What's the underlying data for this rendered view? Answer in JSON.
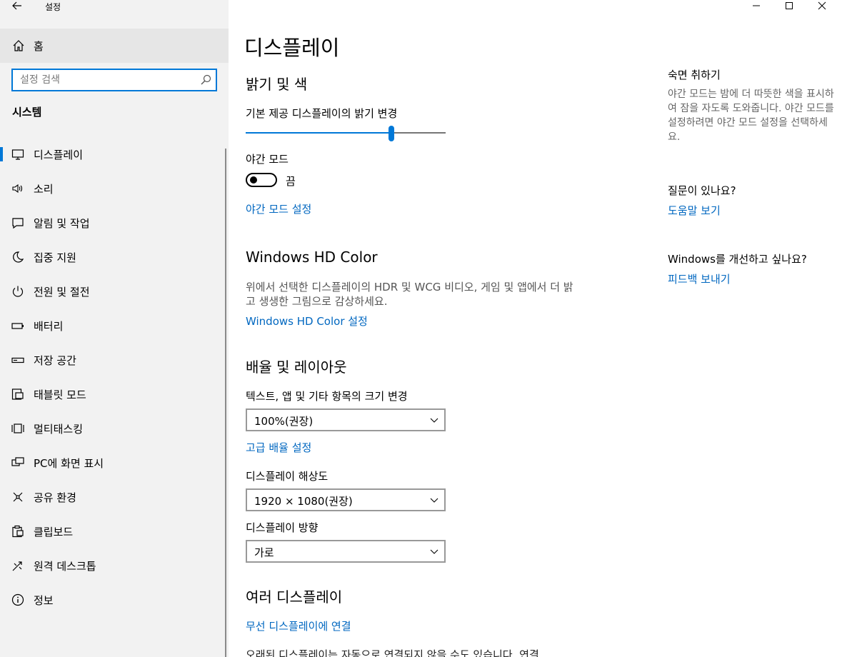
{
  "app": {
    "title": "설정"
  },
  "sidebar": {
    "home_label": "홈",
    "search_placeholder": "설정 검색",
    "section_title": "시스템",
    "items": [
      {
        "label": "디스플레이",
        "icon": "monitor-icon",
        "selected": true
      },
      {
        "label": "소리",
        "icon": "speaker-icon"
      },
      {
        "label": "알림 및 작업",
        "icon": "notification-icon"
      },
      {
        "label": "집중 지원",
        "icon": "moon-icon"
      },
      {
        "label": "전원 및 절전",
        "icon": "power-icon"
      },
      {
        "label": "배터리",
        "icon": "battery-icon"
      },
      {
        "label": "저장 공간",
        "icon": "storage-icon"
      },
      {
        "label": "태블릿 모드",
        "icon": "tablet-icon"
      },
      {
        "label": "멀티태스킹",
        "icon": "multitasking-icon"
      },
      {
        "label": "PC에 화면 표시",
        "icon": "project-icon"
      },
      {
        "label": "공유 환경",
        "icon": "shared-experiences-icon"
      },
      {
        "label": "클립보드",
        "icon": "clipboard-icon"
      },
      {
        "label": "원격 데스크톱",
        "icon": "remote-desktop-icon"
      },
      {
        "label": "정보",
        "icon": "info-icon"
      }
    ]
  },
  "main": {
    "title": "디스플레이",
    "brightness": {
      "heading": "밝기 및 색",
      "slider_label": "기본 제공 디스플레이의 밝기 변경",
      "brightness_value": 0.73,
      "night_light_label": "야간 모드",
      "night_light_state": "끔",
      "night_light_settings_link": "야간 모드 설정"
    },
    "hdr": {
      "heading": "Windows HD Color",
      "description": "위에서 선택한 디스플레이의 HDR 및 WCG 비디오, 게임 및 앱에서 더 밝고 생생한 그림으로 감상하세요.",
      "settings_link": "Windows HD Color 설정"
    },
    "scale": {
      "heading": "배율 및 레이아웃",
      "size_label": "텍스트, 앱 및 기타 항목의 크기 변경",
      "size_value": "100%(권장)",
      "advanced_link": "고급 배율 설정",
      "resolution_label": "디스플레이 해상도",
      "resolution_value": "1920 × 1080(권장)",
      "orientation_label": "디스플레이 방향",
      "orientation_value": "가로"
    },
    "multiple": {
      "heading": "여러 디스플레이",
      "wireless_link": "무선 디스플레이에 연결",
      "cutoff_text": "오래된 디스플레이는 자동으로 연결되지 않을 수도 있습니다. 연결"
    }
  },
  "aside": {
    "sleep_title": "숙면 취하기",
    "sleep_desc": "야간 모드는 밤에 더 따뜻한 색을 표시하여 잠을 자도록 도와줍니다. 야간 모드를 설정하려면 야간 모드 설정을 선택하세요.",
    "question_title": "질문이 있나요?",
    "help_link": "도움말 보기",
    "improve_title": "Windows를 개선하고 싶나요?",
    "feedback_link": "피드백 보내기"
  },
  "colors": {
    "accent": "#0078d7",
    "link": "#0067c0",
    "sidebar_bg": "#f2f2f2"
  }
}
